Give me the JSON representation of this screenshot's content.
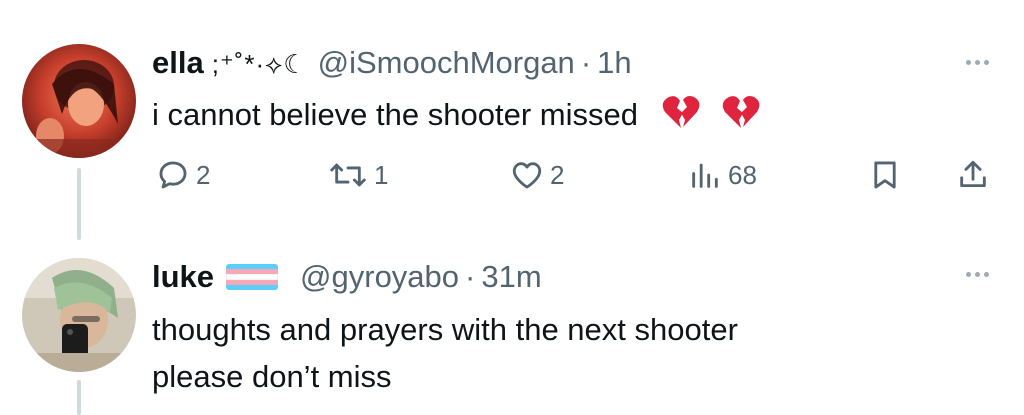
{
  "tweets": [
    {
      "name": "ella",
      "name_decoration": ";⁺˚*·⟡☾",
      "handle": "@iSmoochMorgan",
      "separator": "·",
      "time": "1h",
      "text": "i cannot believe the shooter missed",
      "emoji": [
        "broken-heart",
        "broken-heart"
      ],
      "reply_count": "2",
      "retweet_count": "1",
      "like_count": "2",
      "view_count": "68"
    },
    {
      "name": "luke",
      "handle": "@gyroyabo",
      "separator": "·",
      "time": "31m",
      "text_line1": "thoughts and prayers with the next shooter",
      "text_line2": "please don’t miss",
      "badge": "transgender-flag",
      "flag_colors": [
        "#5bcefa",
        "#f5a9b8",
        "#ffffff",
        "#f5a9b8",
        "#5bcefa"
      ]
    }
  ],
  "colors": {
    "text": "#0f1419",
    "secondary": "#536471",
    "thread_line": "#cfd9de",
    "emoji_red": "#e0243f"
  }
}
